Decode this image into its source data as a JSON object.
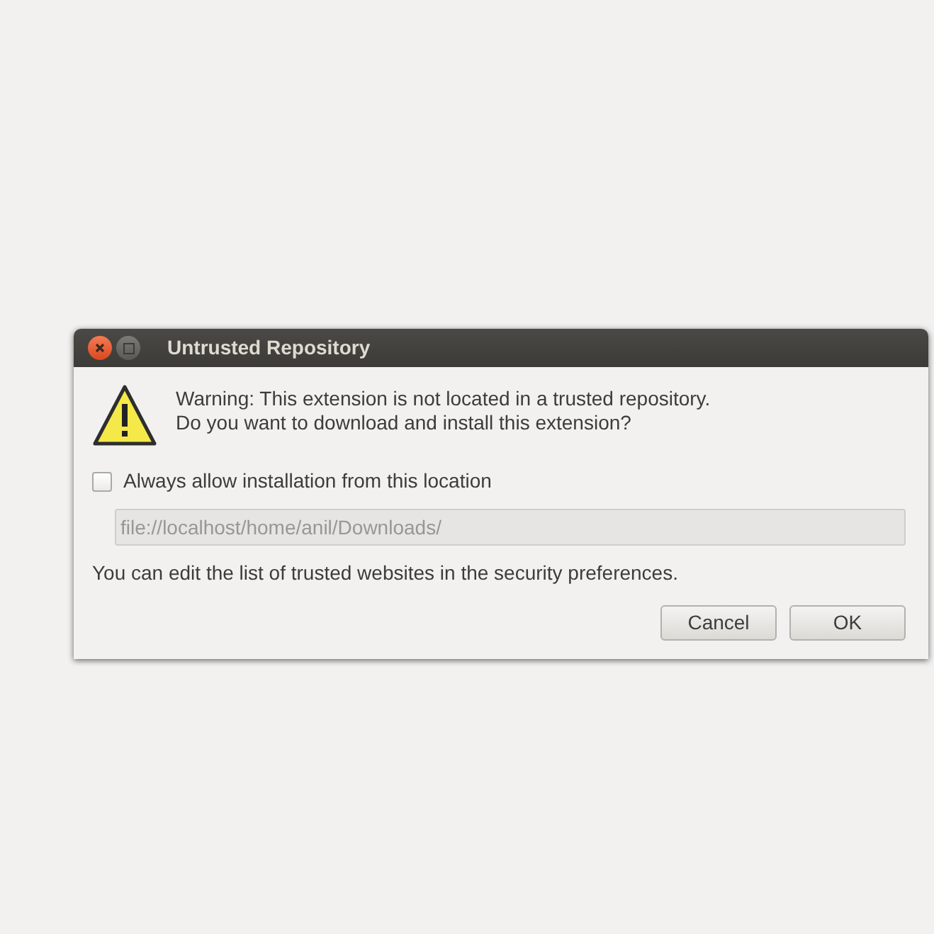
{
  "window": {
    "title": "Untrusted Repository"
  },
  "message": [
    "Warning: This extension is not located in a trusted repository.",
    "Do you want to download and install this extension?"
  ],
  "checkbox": {
    "label": "Always allow installation from this location",
    "checked": false
  },
  "location_field": {
    "value": "file://localhost/home/anil/Downloads/",
    "disabled": true
  },
  "note": "You can edit the list of trusted websites in the security preferences.",
  "buttons": [
    "Cancel",
    "OK"
  ]
}
